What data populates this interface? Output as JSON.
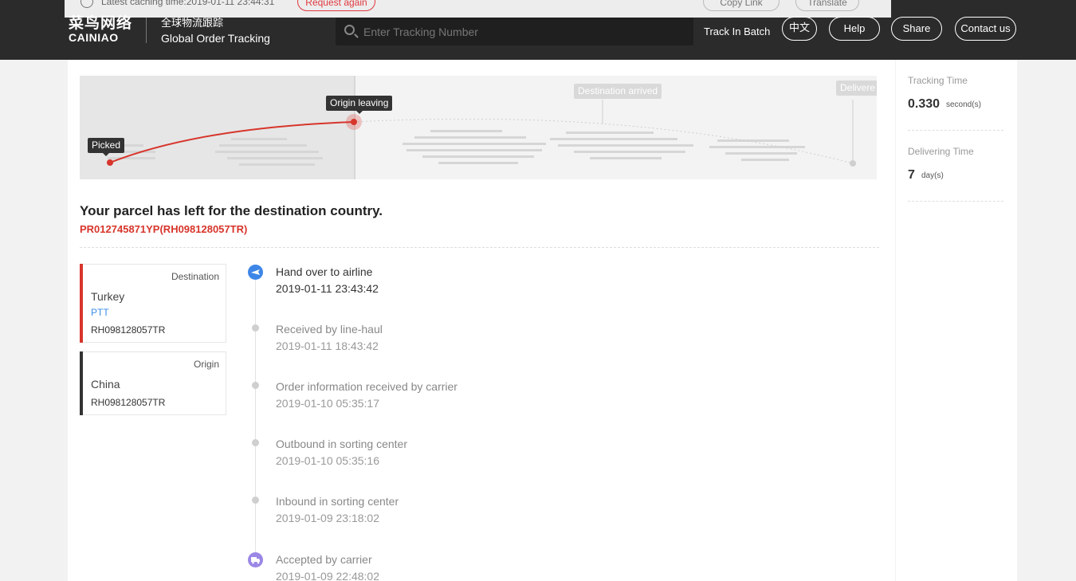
{
  "cache": {
    "text": "Latest caching time:2019-01-11 23:44:31",
    "request_label": "Request again",
    "copy_label": "Copy Link",
    "translate_label": "Translate"
  },
  "header": {
    "logo_cn": "菜鸟网络",
    "logo_en": "CAINIAO",
    "subtitle_cn": "全球物流跟踪",
    "subtitle_en": "Global Order Tracking",
    "search_placeholder": "Enter Tracking Number",
    "batch_label": "Track In Batch",
    "lang_label": "中文",
    "help_label": "Help",
    "share_label": "Share",
    "contact_label": "Contact us"
  },
  "progress": {
    "steps": [
      "Picked",
      "Origin leaving",
      "Destination arrived",
      "Delivere"
    ],
    "active_color": "#d7352b"
  },
  "parcel": {
    "status_title": "Your parcel has left for the destination country.",
    "tracking_id": "PR012745871YP(RH098128057TR)"
  },
  "route": {
    "destination": {
      "type_label": "Destination",
      "country": "Turkey",
      "carrier": "PTT",
      "number": "RH098128057TR"
    },
    "origin": {
      "type_label": "Origin",
      "country": "China",
      "number": "RH098128057TR"
    }
  },
  "timeline": [
    {
      "title": "Hand over to airline",
      "time": "2019-01-11 23:43:42",
      "icon": "plane-icon"
    },
    {
      "title": "Received by line-haul",
      "time": "2019-01-11 18:43:42"
    },
    {
      "title": "Order information received by carrier",
      "time": "2019-01-10 05:35:17"
    },
    {
      "title": "Outbound in sorting center",
      "time": "2019-01-10 05:35:16"
    },
    {
      "title": "Inbound in sorting center",
      "time": "2019-01-09 23:18:02"
    },
    {
      "title": "Accepted by carrier",
      "time": "2019-01-09 22:48:02",
      "icon": "truck-icon"
    }
  ],
  "stats": {
    "tracking_label": "Tracking Time",
    "tracking_value": "0.330",
    "tracking_unit": "second(s)",
    "delivering_label": "Delivering Time",
    "delivering_value": "7",
    "delivering_unit": "day(s)"
  }
}
